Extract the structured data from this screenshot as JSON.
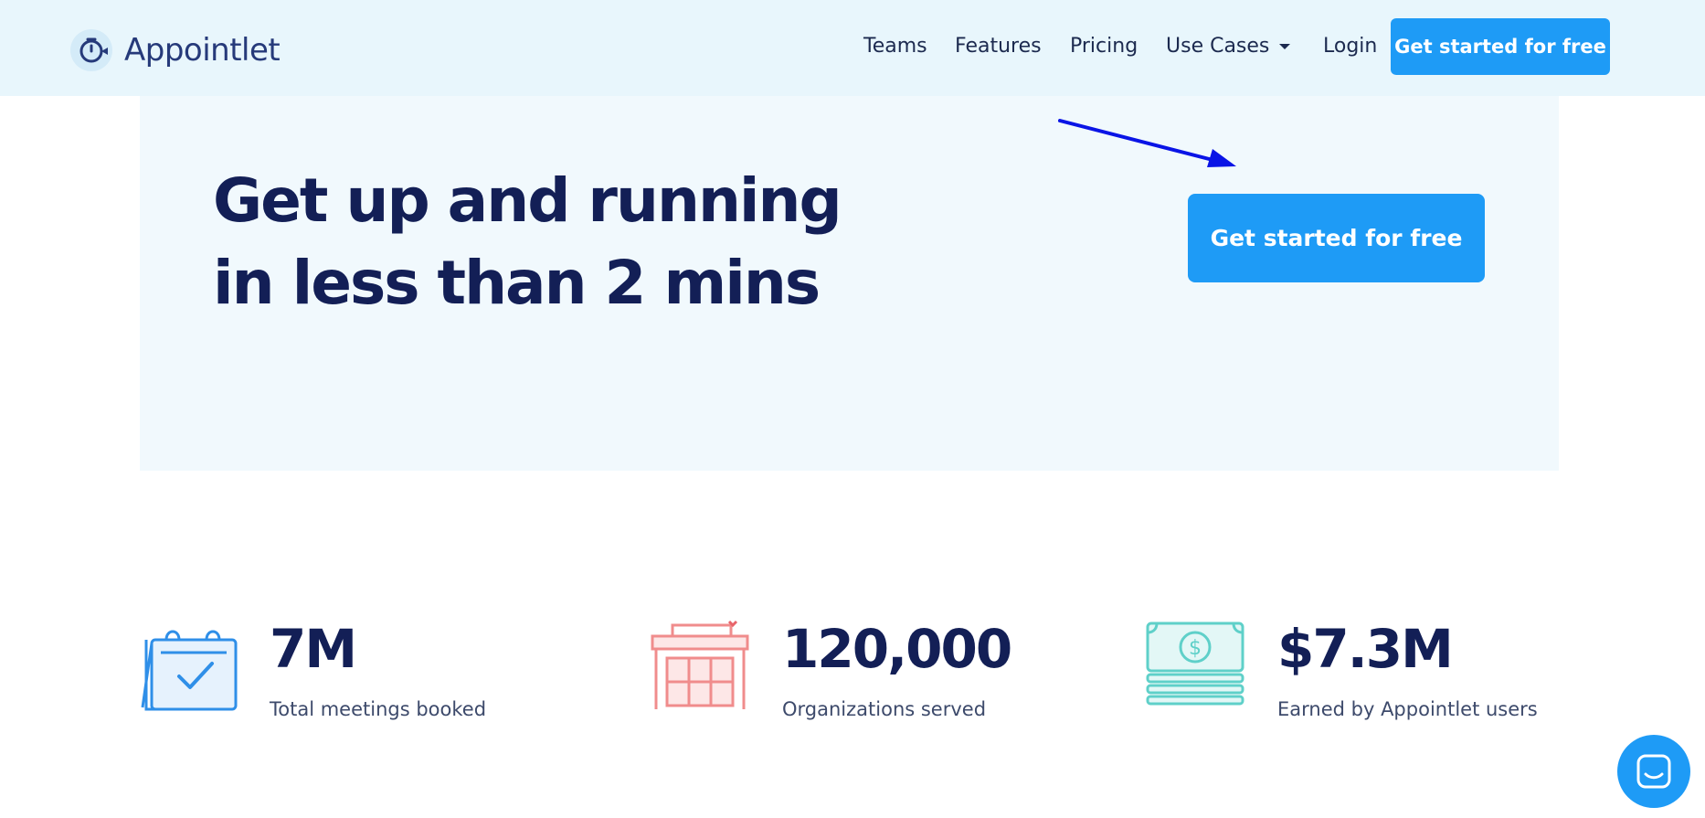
{
  "brand": {
    "name": "Appointlet",
    "logo_icon": "clock-bird-logo-icon",
    "accent": "#1e9bf6",
    "heading_color": "#131f56"
  },
  "nav": {
    "teams": "Teams",
    "features": "Features",
    "pricing": "Pricing",
    "use_cases": "Use Cases",
    "login": "Login",
    "cta": "Get started for free"
  },
  "hero": {
    "heading_line1": "Get up and running",
    "heading_line2": "in less than 2 mins",
    "cta": "Get started for free"
  },
  "stats": [
    {
      "icon": "calendar-check-icon",
      "value": "7M",
      "label": "Total meetings booked",
      "color": "#2f8fe8"
    },
    {
      "icon": "building-icon",
      "value": "120,000",
      "label": "Organizations served",
      "color": "#f08c8c"
    },
    {
      "icon": "money-stack-icon",
      "value": "$7.3M",
      "label": "Earned by Appointlet users",
      "color": "#5fd0c9"
    }
  ],
  "chat": {
    "icon": "chat-icon"
  }
}
